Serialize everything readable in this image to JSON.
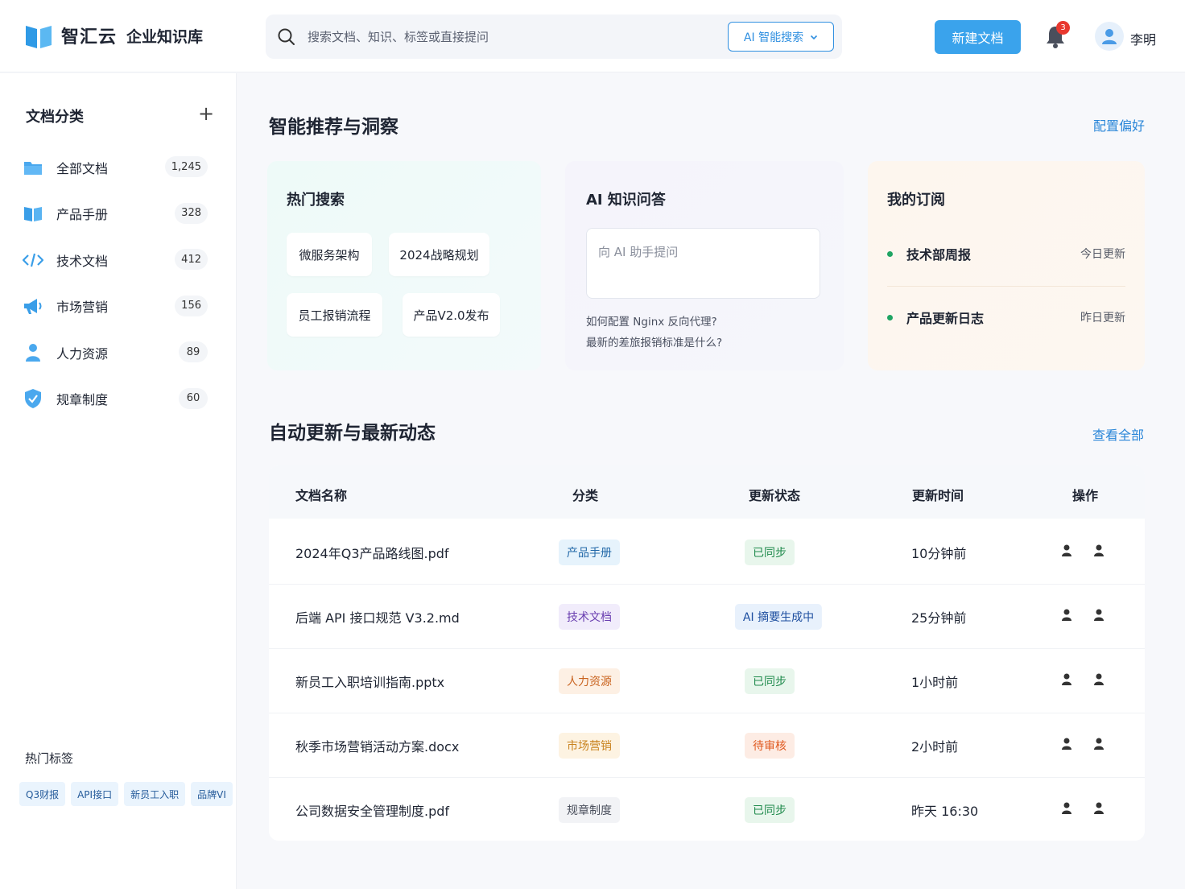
{
  "header": {
    "brand": "智汇云",
    "subtitle": "企业知识库",
    "search_placeholder": "搜索文档、知识、标签或直接提问",
    "ai_search_label": "AI 智能搜索",
    "new_doc_label": "新建文档",
    "notification_count": "3",
    "user_name": "李明"
  },
  "sidebar": {
    "title": "文档分类",
    "items": [
      {
        "label": "全部文档",
        "count": "1,245",
        "icon": "folder-icon"
      },
      {
        "label": "产品手册",
        "count": "328",
        "icon": "book-icon"
      },
      {
        "label": "技术文档",
        "count": "412",
        "icon": "code-icon"
      },
      {
        "label": "市场营销",
        "count": "156",
        "icon": "megaphone-icon"
      },
      {
        "label": "人力资源",
        "count": "89",
        "icon": "person-icon"
      },
      {
        "label": "规章制度",
        "count": "60",
        "icon": "shield-icon"
      }
    ],
    "tags_title": "热门标签",
    "tags": [
      "Q3财报",
      "API接口",
      "新员工入职",
      "品牌VI"
    ]
  },
  "insights": {
    "title": "智能推荐与洞察",
    "link": "配置偏好",
    "hot": {
      "title": "热门搜索",
      "chips": [
        "微服务架构",
        "2024战略规划",
        "员工报销流程",
        "产品V2.0发布"
      ]
    },
    "ai": {
      "title": "AI 知识问答",
      "placeholder": "向 AI 助手提问",
      "questions": [
        "如何配置 Nginx 反向代理?",
        "最新的差旅报销标准是什么?"
      ]
    },
    "subs": {
      "title": "我的订阅",
      "items": [
        {
          "name": "技术部周报",
          "time": "今日更新"
        },
        {
          "name": "产品更新日志",
          "time": "昨日更新"
        }
      ]
    }
  },
  "updates": {
    "title": "自动更新与最新动态",
    "link": "查看全部",
    "columns": [
      "文档名称",
      "分类",
      "更新状态",
      "更新时间",
      "操作"
    ],
    "rows": [
      {
        "name": "2024年Q3产品路线图.pdf",
        "category": "产品手册",
        "status": "已同步",
        "time": "10分钟前"
      },
      {
        "name": "后端 API 接口规范 V3.2.md",
        "category": "技术文档",
        "status": "AI 摘要生成中",
        "time": "25分钟前"
      },
      {
        "name": "新员工入职培训指南.pptx",
        "category": "人力资源",
        "status": "已同步",
        "time": "1小时前"
      },
      {
        "name": "秋季市场营销活动方案.docx",
        "category": "市场营销",
        "status": "待审核",
        "time": "2小时前"
      },
      {
        "name": "公司数据安全管理制度.pdf",
        "category": "规章制度",
        "status": "已同步",
        "time": "昨天 16:30"
      }
    ]
  },
  "colors": {
    "accent": "#3aa3ec",
    "link": "#2a86d8",
    "badge": "#e8382f",
    "synced": "#1f8a4c",
    "pending": "#e0591f",
    "ai": "#1e4fa0"
  }
}
